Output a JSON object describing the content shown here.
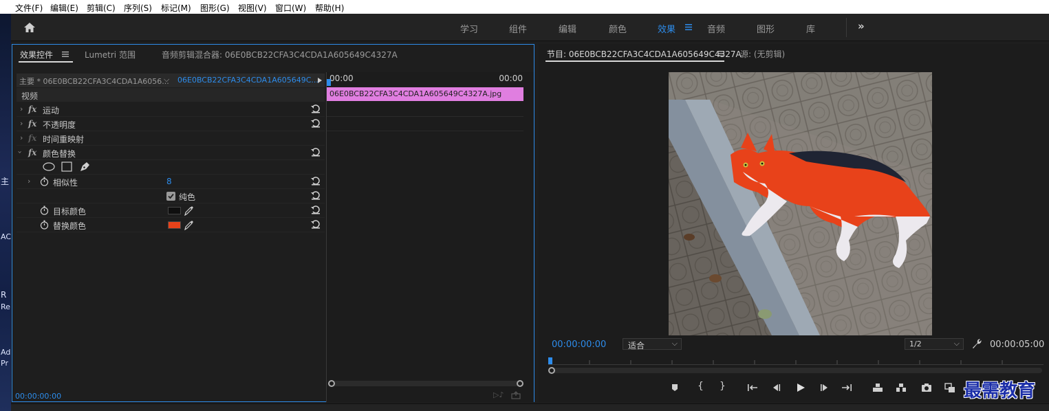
{
  "menu": [
    "文件(F)",
    "编辑(E)",
    "剪辑(C)",
    "序列(S)",
    "标记(M)",
    "图形(G)",
    "视图(V)",
    "窗口(W)",
    "帮助(H)"
  ],
  "desktop_labels": [
    "主",
    "AC",
    "R",
    "Re",
    "Ad",
    "Pr"
  ],
  "workspaces": [
    "学习",
    "组件",
    "编辑",
    "颜色",
    "效果",
    "音频",
    "图形",
    "库"
  ],
  "active_workspace": "效果",
  "effect_panel": {
    "tabs": [
      "效果控件",
      "Lumetri 范围",
      "音频剪辑混合器: 06E0BCB22CFA3C4CDA1A605649C4327A"
    ],
    "master": "主要 * 06E0BCB22CFA3C4CDA1A6056...",
    "clip": "06E0BCB22CFA3C4CDA1A605649C...",
    "time_start": "00:00",
    "time_end": "00:00",
    "clip_bar": "06E0BCB22CFA3C4CDA1A605649C4327A.jpg",
    "section_video": "视频",
    "effects": [
      "运动",
      "不透明度",
      "时间重映射",
      "颜色替换"
    ],
    "similarity_label": "相似性",
    "similarity_value": "8",
    "solid_label": "纯色",
    "target_label": "目标颜色",
    "replace_label": "替换颜色",
    "target_color": "#0f0f0f",
    "replace_color": "#e8421a",
    "timecode": "00:00:00:00"
  },
  "program_panel": {
    "tabs": [
      "节目: 06E0BCB22CFA3C4CDA1A605649C4327A",
      "源: (无剪辑)"
    ],
    "timecode": "00:00:00:00",
    "fit": "适合",
    "resolution": "1/2",
    "duration": "00:00:05:00"
  },
  "watermark": "最需教育",
  "colors": {
    "accent": "#2d8ceb",
    "clip": "#e07ee0"
  }
}
